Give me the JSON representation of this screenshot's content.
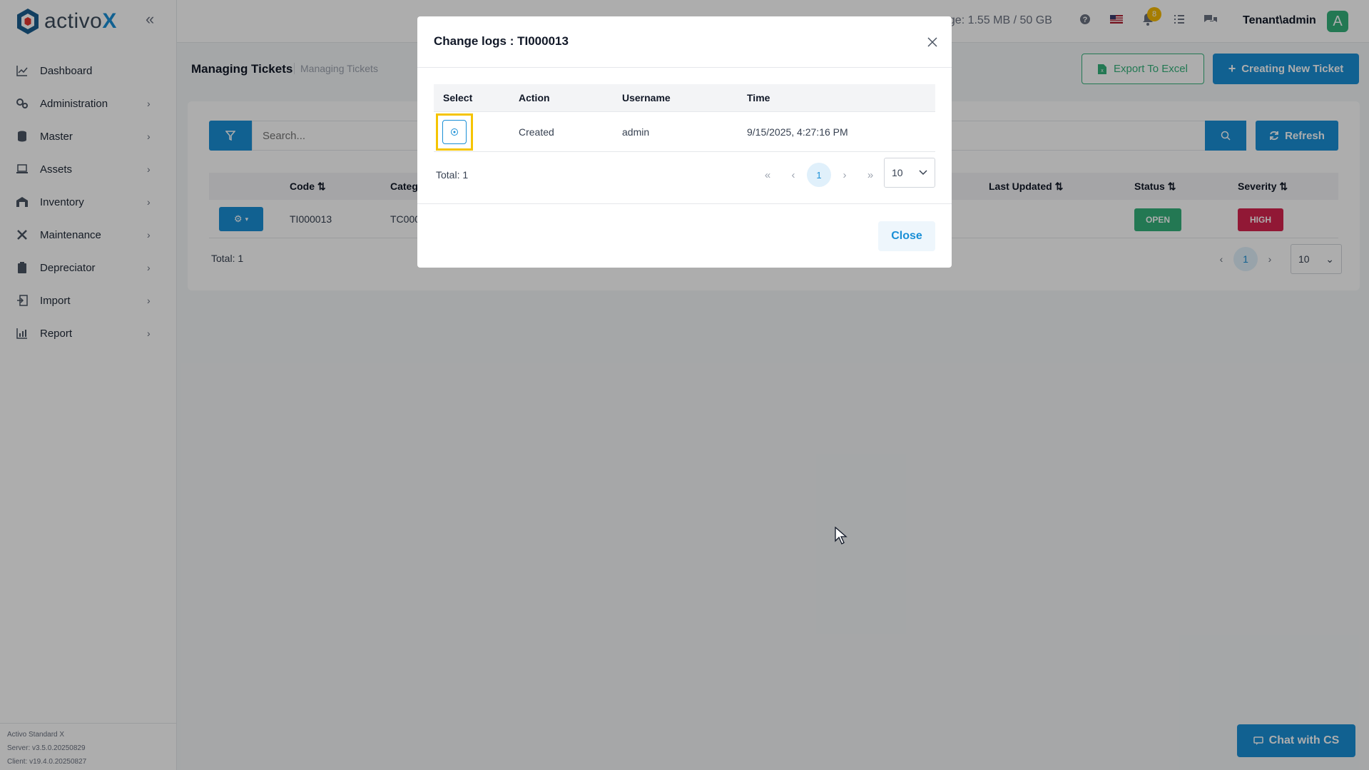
{
  "app": {
    "logo_text": "activo",
    "logo_x": "X",
    "brand_color": "#1a8fd6"
  },
  "sidebar": {
    "items": [
      {
        "label": "Dashboard",
        "icon": "chart-line-icon"
      },
      {
        "label": "Administration",
        "icon": "gears-icon"
      },
      {
        "label": "Master",
        "icon": "database-icon"
      },
      {
        "label": "Assets",
        "icon": "laptop-icon"
      },
      {
        "label": "Inventory",
        "icon": "warehouse-icon"
      },
      {
        "label": "Maintenance",
        "icon": "tools-icon"
      },
      {
        "label": "Depreciator",
        "icon": "clipboard-icon"
      },
      {
        "label": "Import",
        "icon": "import-icon"
      },
      {
        "label": "Report",
        "icon": "bar-chart-icon"
      }
    ],
    "footer": {
      "product": "Activo Standard X",
      "server": "Server: v3.5.0.20250829",
      "client": "Client: v19.4.0.20250827"
    }
  },
  "topbar": {
    "storage": "age: 1.55 MB / 50 GB",
    "notification_count": "8",
    "user": "Tenant\\admin",
    "avatar_letter": "A"
  },
  "page": {
    "title": "Managing Tickets",
    "breadcrumb": "Managing Tickets",
    "export_label": "Export To Excel",
    "create_label": "Creating New Ticket",
    "search_placeholder": "Search...",
    "refresh_label": "Refresh",
    "columns": {
      "code": "Code",
      "category": "Catego",
      "last_updated": "Last Updated",
      "status": "Status",
      "severity": "Severity"
    },
    "rows": [
      {
        "code": "TI000013",
        "category": "TC0000",
        "status": "OPEN",
        "severity": "HIGH"
      }
    ],
    "total": "Total: 1",
    "current_page": "1",
    "page_size": "10"
  },
  "modal": {
    "title": "Change logs : TI000013",
    "columns": {
      "select": "Select",
      "action": "Action",
      "username": "Username",
      "time": "Time"
    },
    "rows": [
      {
        "action": "Created",
        "username": "admin",
        "time": "9/15/2025, 4:27:16 PM"
      }
    ],
    "total": "Total: 1",
    "current_page": "1",
    "page_size": "10",
    "close_label": "Close"
  },
  "chat": {
    "label": "Chat with CS"
  },
  "colors": {
    "open": "#34b27b",
    "high": "#d6244f",
    "highlight": "#f5c400"
  }
}
